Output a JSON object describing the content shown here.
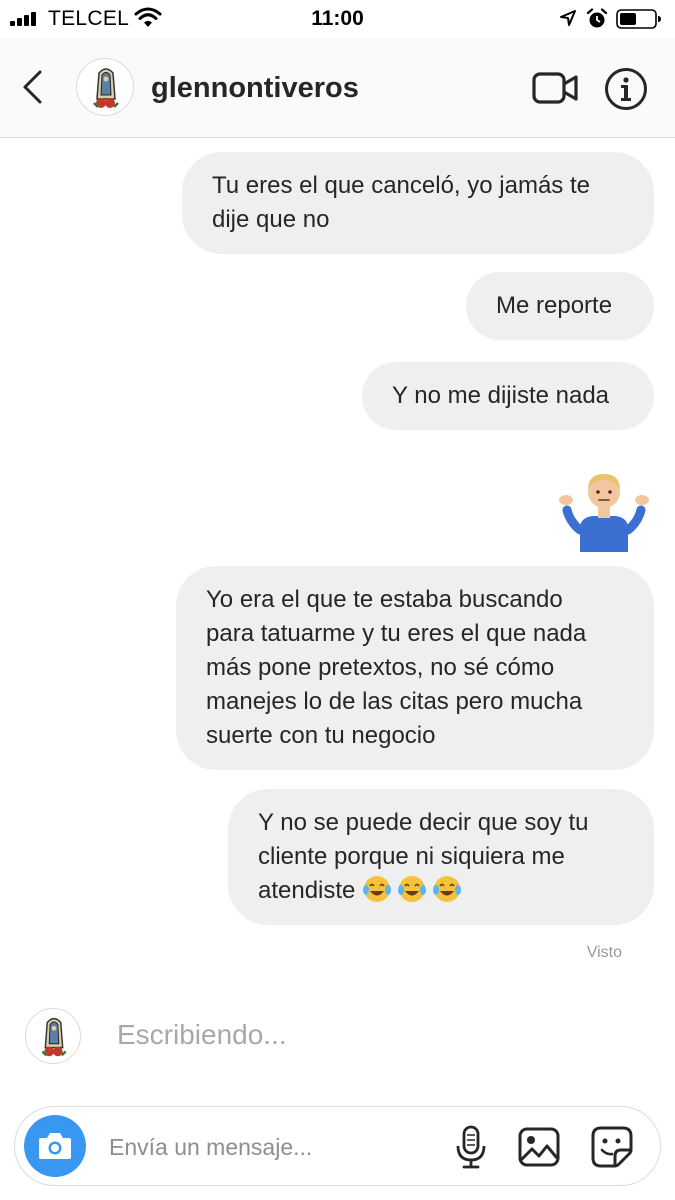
{
  "status_bar": {
    "carrier": "TELCEL",
    "time": "11:00",
    "icons": [
      "signal-icon",
      "wifi-icon",
      "location-icon",
      "alarm-icon",
      "battery-icon"
    ]
  },
  "header": {
    "username": "glennontiveros",
    "icons": [
      "back-arrow-icon",
      "video-call-icon",
      "info-icon"
    ]
  },
  "messages": [
    {
      "from": "me",
      "text": "Tu eres el que canceló, yo jamás te\ndije que no"
    },
    {
      "from": "me",
      "text": "Me reporte"
    },
    {
      "from": "me",
      "text": "Y no me dijiste nada"
    },
    {
      "from": "me",
      "emoji": "person-shrugging-emoji"
    },
    {
      "from": "me",
      "text": "Yo era el que te estaba buscando\npara tatuarme y tu eres el que nada\nmás pone pretextos, no sé cómo\nmanejes lo de las citas pero mucha\nsuerte con tu negocio"
    },
    {
      "from": "me",
      "text_line1": "Y no se puede decir que soy tu",
      "text_line2": "cliente porque ni siquiera me",
      "text_line3": "atendiste",
      "emojis": [
        "tears-of-joy-emoji",
        "tears-of-joy-emoji",
        "tears-of-joy-emoji"
      ]
    }
  ],
  "seen_label": "Visto",
  "typing_label": "Escribiendo...",
  "composer": {
    "placeholder": "Envía un mensaje...",
    "icons": [
      "camera-icon",
      "microphone-icon",
      "gallery-icon",
      "sticker-icon"
    ]
  },
  "colors": {
    "bubble": "#efefef",
    "accent": "#3897f0",
    "text": "#262626",
    "muted": "#8e8e8e"
  }
}
